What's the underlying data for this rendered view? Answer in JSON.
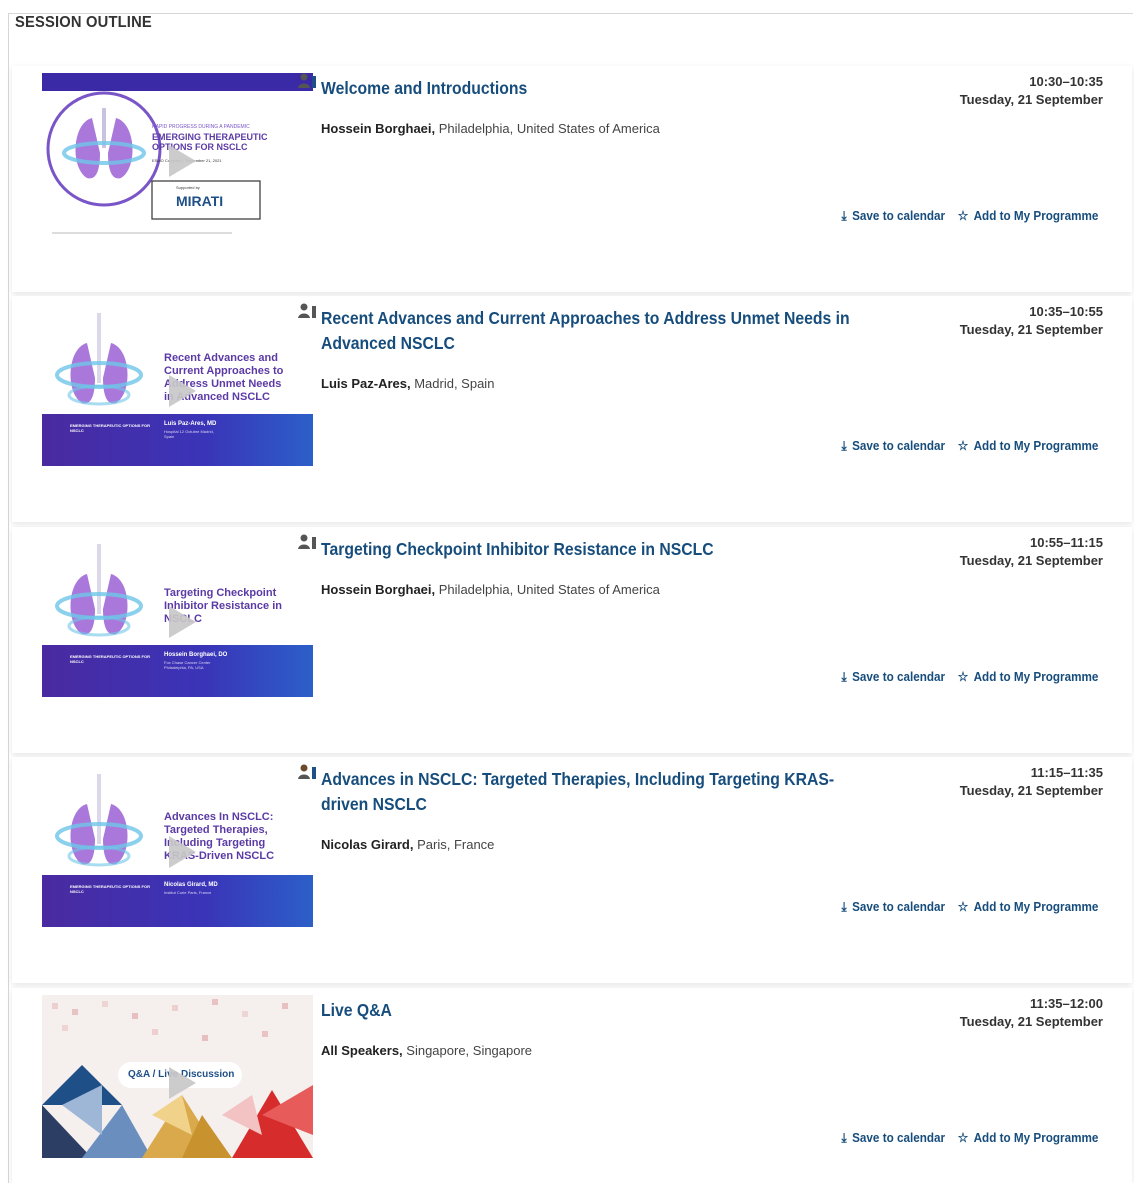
{
  "section_title": "SESSION OUTLINE",
  "actions": {
    "save_label": "Save to calendar",
    "add_label": "Add to My Programme",
    "save_icon": "download-icon",
    "add_icon": "star-outline-icon"
  },
  "items": [
    {
      "title": "Welcome and Introductions",
      "speaker": "Hossein Borghaei,",
      "location": "Philadelphia, United States of America",
      "time": "10:30–10:35",
      "date": "Tuesday, 21 September",
      "thumb": {
        "line1": "RAPID PROGRESS DURING A PANDEMIC",
        "line2": "EMERGING THERAPEUTIC",
        "line3": "OPTIONS FOR NSCLC",
        "line4": "ESMO Congress | September 21, 2021",
        "sponsor_label": "Supported by",
        "sponsor": "MIRATI"
      }
    },
    {
      "title": "Recent Advances and Current Approaches to Address Unmet Needs in Advanced NSCLC",
      "speaker": "Luis Paz-Ares,",
      "location": "Madrid, Spain",
      "time": "10:35–10:55",
      "date": "Tuesday, 21 September",
      "thumb": {
        "text": "Recent Advances and Current Approaches to Address Unmet Needs in Advanced NSCLC",
        "presenter": "Luis Paz-Ares, MD",
        "presenter_sub": "Hospital 12 Octubre Madrid, Spain",
        "banner": "EMERGING THERAPEUTIC OPTIONS FOR NSCLC"
      }
    },
    {
      "title": "Targeting Checkpoint Inhibitor Resistance in NSCLC",
      "speaker": "Hossein Borghaei,",
      "location": "Philadelphia, United States of America",
      "time": "10:55–11:15",
      "date": "Tuesday, 21 September",
      "thumb": {
        "text": "Targeting Checkpoint Inhibitor Resistance in NSCLC",
        "presenter": "Hossein Borghaei, DO",
        "presenter_sub": "Fox Chase Cancer Center Philadelphia, PA, USA",
        "banner": "EMERGING THERAPEUTIC OPTIONS FOR NSCLC"
      }
    },
    {
      "title": "Advances in NSCLC: Targeted Therapies, Including Targeting KRAS-driven NSCLC",
      "speaker": "Nicolas Girard,",
      "location": "Paris, France",
      "time": "11:15–11:35",
      "date": "Tuesday, 21 September",
      "thumb": {
        "text": "Advances In NSCLC: Targeted Therapies, Including Targeting KRAS-Driven NSCLC",
        "presenter": "Nicolas Girard, MD",
        "presenter_sub": "Institut Curie Paris, France",
        "banner": "EMERGING THERAPEUTIC OPTIONS FOR NSCLC"
      }
    },
    {
      "title": "Live Q&A",
      "speaker": "All Speakers,",
      "location": "Singapore, Singapore",
      "time": "11:35–12:00",
      "date": "Tuesday, 21 September",
      "thumb": {
        "pill": "Q&A / Live Discussion"
      }
    }
  ]
}
